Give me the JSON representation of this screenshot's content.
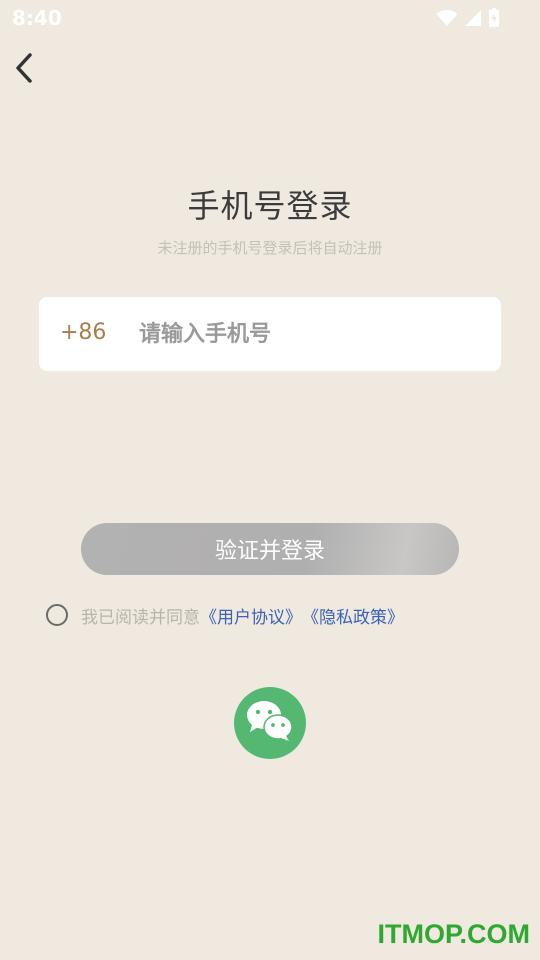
{
  "status_bar": {
    "time": "8:40",
    "icons": [
      "wifi-icon",
      "signal-icon",
      "battery-icon"
    ]
  },
  "header": {
    "back_icon": "chevron-left-icon"
  },
  "login": {
    "title": "手机号登录",
    "subtitle": "未注册的手机号登录后将自动注册",
    "country_code": "+86",
    "phone_placeholder": "请输入手机号",
    "phone_value": "",
    "submit_label": "验证并登录"
  },
  "agreement": {
    "checked": false,
    "text": "我已阅读并同意",
    "user_agreement": "《用户协议》",
    "privacy_policy": "《隐私政策》"
  },
  "third_party": {
    "wechat_icon": "wechat-icon"
  },
  "watermark": {
    "text": "ITMOP.COM"
  },
  "colors": {
    "background": "#efe9e0",
    "country_code": "#a8804f",
    "link": "#3a63b8",
    "wechat": "#55b872",
    "watermark": "#2fa82f"
  }
}
